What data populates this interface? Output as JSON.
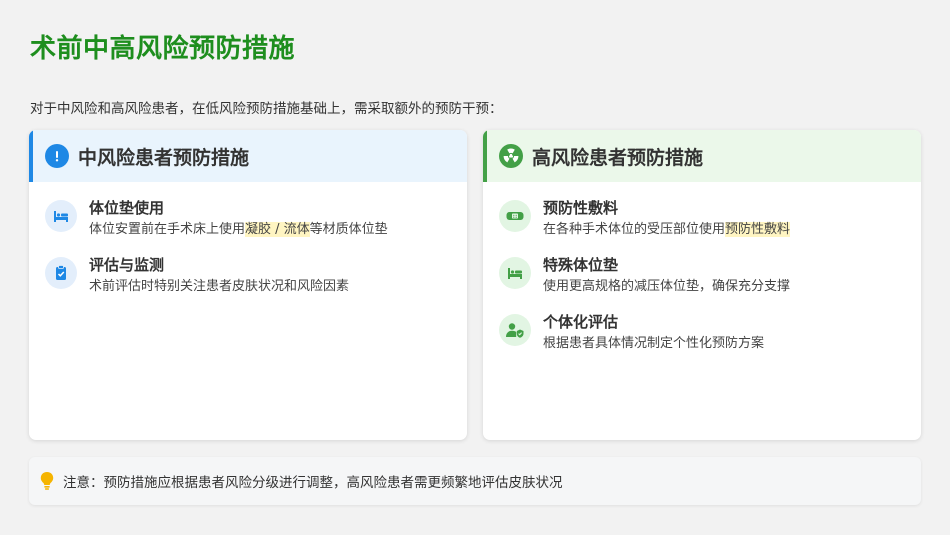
{
  "title": "术前中高风险预防措施",
  "intro": "对于中风险和高风险患者，在低风险预防措施基础上，需采取额外的预防干预：",
  "colors": {
    "title": "#1e8e1e",
    "blue_accent": "#1e88e5",
    "green_accent": "#43a047",
    "highlight": "#fff5c2",
    "notice_icon": "#f5b400"
  },
  "left_card": {
    "title": "中风险患者预防措施",
    "icon": "exclamation-icon",
    "items": [
      {
        "icon": "bed-icon",
        "title": "体位垫使用",
        "desc_pre": "体位安置前在手术床上使用",
        "desc_hl": "凝胶 / 流体",
        "desc_post": "等材质体位垫"
      },
      {
        "icon": "clipboard-check-icon",
        "title": "评估与监测",
        "desc": "术前评估时特别关注患者皮肤状况和风险因素"
      }
    ]
  },
  "right_card": {
    "title": "高风险患者预防措施",
    "icon": "radiation-icon",
    "items": [
      {
        "icon": "bandage-icon",
        "title": "预防性敷料",
        "desc_pre": "在各种手术体位的受压部位使用",
        "desc_hl": "预防性敷料"
      },
      {
        "icon": "bed-icon",
        "title": "特殊体位垫",
        "desc": "使用更高规格的减压体位垫，确保充分支撑"
      },
      {
        "icon": "user-shield-icon",
        "title": "个体化评估",
        "desc": "根据患者具体情况制定个性化预防方案"
      }
    ]
  },
  "notice": {
    "icon": "lightbulb-icon",
    "text": "注意：预防措施应根据患者风险分级进行调整，高风险患者需更频繁地评估皮肤状况"
  }
}
